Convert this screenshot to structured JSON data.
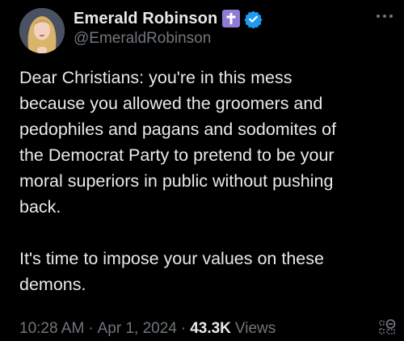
{
  "author": {
    "display_name": "Emerald Robinson",
    "handle": "@EmeraldRobinson",
    "badges": [
      "cross-icon",
      "verified-icon"
    ]
  },
  "tweet": {
    "paragraphs": [
      "Dear Christians: you're in this mess\nbecause you allowed the groomers and\npedophiles and pagans and sodomites of\nthe Democrat Party to pretend to be your\nmoral superiors in public without pushing\nback.",
      "It's time to impose your values on these\ndemons."
    ]
  },
  "meta": {
    "time": "10:28 AM",
    "separator": "·",
    "date": "Apr 1, 2024",
    "views_count": "43.3K",
    "views_label": "Views"
  },
  "colors": {
    "background": "#000000",
    "text_primary": "#e7e9ea",
    "text_secondary": "#71767b",
    "verified_blue": "#1d9bf0",
    "cross_badge": "#8e7bd6"
  },
  "icons": {
    "more": "more-horizontal-icon",
    "footer": "bookmark-grid-icon"
  }
}
